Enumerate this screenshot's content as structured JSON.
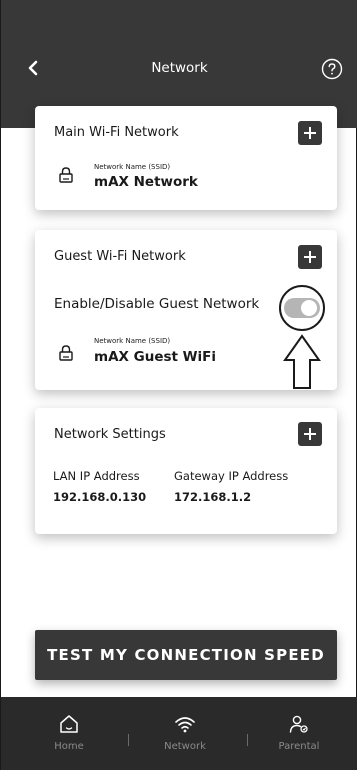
{
  "header": {
    "title": "Network",
    "back_icon": "chevron-left-icon",
    "help_icon": "question-circle-icon"
  },
  "main_wifi": {
    "title": "Main Wi-Fi Network",
    "ssid_label": "Network Name (SSID)",
    "ssid_value": "mAX Network"
  },
  "guest_wifi": {
    "title": "Guest Wi-Fi Network",
    "toggle_label": "Enable/Disable Guest Network",
    "toggle_state": "off",
    "ssid_label": "Network Name (SSID)",
    "ssid_value": "mAX Guest WiFi"
  },
  "network_settings": {
    "title": "Network Settings",
    "lan_label": "LAN IP Address",
    "lan_value": "192.168.0.130",
    "gateway_label": "Gateway IP Address",
    "gateway_value": "172.168.1.2"
  },
  "speed_test": {
    "label": "TEST MY CONNECTION SPEED"
  },
  "tabs": [
    {
      "label": "Home",
      "icon": "home-icon"
    },
    {
      "label": "Network",
      "icon": "wifi-icon"
    },
    {
      "label": "Parental",
      "icon": "parental-icon"
    }
  ],
  "colors": {
    "header_bg": "#383838",
    "tabbar_bg": "#2a2a2a",
    "button_bg": "#383838",
    "toggle_off": "#b5b5b5"
  }
}
